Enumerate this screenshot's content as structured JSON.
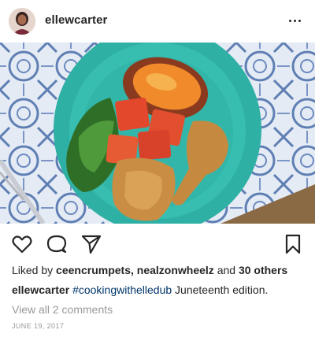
{
  "post": {
    "username": "ellewcarter",
    "likes_prefix": "Liked by",
    "liker_1": "ceencrumpets",
    "liker_separator": ",",
    "liker_2": "nealzonwheelz",
    "likes_and": "and",
    "others": "30 others",
    "caption_username": "ellewcarter",
    "caption_hashtag": "#cookingwithelledub",
    "caption_text": "Juneteenth edition.",
    "view_comments": "View all 2 comments",
    "date": "JUNE 19, 2017"
  },
  "icons": {
    "more": "more-horizontal-icon",
    "like": "heart-icon",
    "comment": "comment-icon",
    "share": "send-icon",
    "save": "bookmark-icon"
  },
  "colors": {
    "text": "#262626",
    "muted": "#999999",
    "hashtag": "#003569",
    "plate": "#2fb3a7",
    "tablecloth": "#dfe7f2"
  }
}
